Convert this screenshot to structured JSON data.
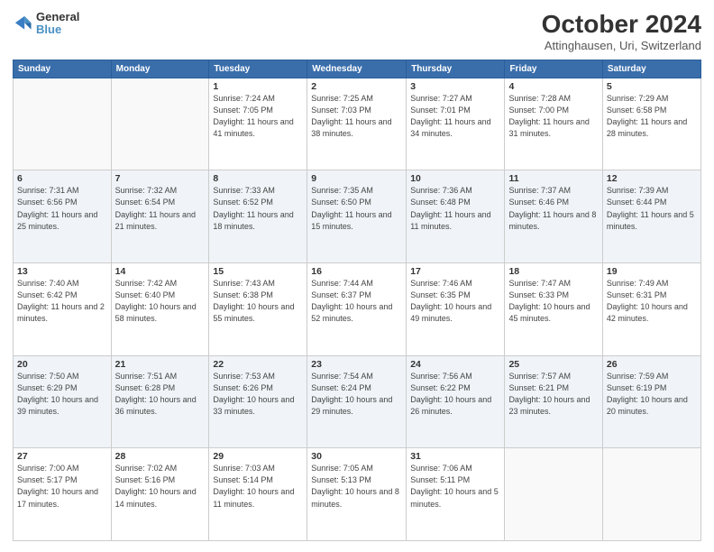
{
  "header": {
    "logo": {
      "line1": "General",
      "line2": "Blue"
    },
    "title": "October 2024",
    "location": "Attinghausen, Uri, Switzerland"
  },
  "days_of_week": [
    "Sunday",
    "Monday",
    "Tuesday",
    "Wednesday",
    "Thursday",
    "Friday",
    "Saturday"
  ],
  "weeks": [
    [
      {
        "day": "",
        "info": ""
      },
      {
        "day": "",
        "info": ""
      },
      {
        "day": "1",
        "info": "Sunrise: 7:24 AM\nSunset: 7:05 PM\nDaylight: 11 hours and 41 minutes."
      },
      {
        "day": "2",
        "info": "Sunrise: 7:25 AM\nSunset: 7:03 PM\nDaylight: 11 hours and 38 minutes."
      },
      {
        "day": "3",
        "info": "Sunrise: 7:27 AM\nSunset: 7:01 PM\nDaylight: 11 hours and 34 minutes."
      },
      {
        "day": "4",
        "info": "Sunrise: 7:28 AM\nSunset: 7:00 PM\nDaylight: 11 hours and 31 minutes."
      },
      {
        "day": "5",
        "info": "Sunrise: 7:29 AM\nSunset: 6:58 PM\nDaylight: 11 hours and 28 minutes."
      }
    ],
    [
      {
        "day": "6",
        "info": "Sunrise: 7:31 AM\nSunset: 6:56 PM\nDaylight: 11 hours and 25 minutes."
      },
      {
        "day": "7",
        "info": "Sunrise: 7:32 AM\nSunset: 6:54 PM\nDaylight: 11 hours and 21 minutes."
      },
      {
        "day": "8",
        "info": "Sunrise: 7:33 AM\nSunset: 6:52 PM\nDaylight: 11 hours and 18 minutes."
      },
      {
        "day": "9",
        "info": "Sunrise: 7:35 AM\nSunset: 6:50 PM\nDaylight: 11 hours and 15 minutes."
      },
      {
        "day": "10",
        "info": "Sunrise: 7:36 AM\nSunset: 6:48 PM\nDaylight: 11 hours and 11 minutes."
      },
      {
        "day": "11",
        "info": "Sunrise: 7:37 AM\nSunset: 6:46 PM\nDaylight: 11 hours and 8 minutes."
      },
      {
        "day": "12",
        "info": "Sunrise: 7:39 AM\nSunset: 6:44 PM\nDaylight: 11 hours and 5 minutes."
      }
    ],
    [
      {
        "day": "13",
        "info": "Sunrise: 7:40 AM\nSunset: 6:42 PM\nDaylight: 11 hours and 2 minutes."
      },
      {
        "day": "14",
        "info": "Sunrise: 7:42 AM\nSunset: 6:40 PM\nDaylight: 10 hours and 58 minutes."
      },
      {
        "day": "15",
        "info": "Sunrise: 7:43 AM\nSunset: 6:38 PM\nDaylight: 10 hours and 55 minutes."
      },
      {
        "day": "16",
        "info": "Sunrise: 7:44 AM\nSunset: 6:37 PM\nDaylight: 10 hours and 52 minutes."
      },
      {
        "day": "17",
        "info": "Sunrise: 7:46 AM\nSunset: 6:35 PM\nDaylight: 10 hours and 49 minutes."
      },
      {
        "day": "18",
        "info": "Sunrise: 7:47 AM\nSunset: 6:33 PM\nDaylight: 10 hours and 45 minutes."
      },
      {
        "day": "19",
        "info": "Sunrise: 7:49 AM\nSunset: 6:31 PM\nDaylight: 10 hours and 42 minutes."
      }
    ],
    [
      {
        "day": "20",
        "info": "Sunrise: 7:50 AM\nSunset: 6:29 PM\nDaylight: 10 hours and 39 minutes."
      },
      {
        "day": "21",
        "info": "Sunrise: 7:51 AM\nSunset: 6:28 PM\nDaylight: 10 hours and 36 minutes."
      },
      {
        "day": "22",
        "info": "Sunrise: 7:53 AM\nSunset: 6:26 PM\nDaylight: 10 hours and 33 minutes."
      },
      {
        "day": "23",
        "info": "Sunrise: 7:54 AM\nSunset: 6:24 PM\nDaylight: 10 hours and 29 minutes."
      },
      {
        "day": "24",
        "info": "Sunrise: 7:56 AM\nSunset: 6:22 PM\nDaylight: 10 hours and 26 minutes."
      },
      {
        "day": "25",
        "info": "Sunrise: 7:57 AM\nSunset: 6:21 PM\nDaylight: 10 hours and 23 minutes."
      },
      {
        "day": "26",
        "info": "Sunrise: 7:59 AM\nSunset: 6:19 PM\nDaylight: 10 hours and 20 minutes."
      }
    ],
    [
      {
        "day": "27",
        "info": "Sunrise: 7:00 AM\nSunset: 5:17 PM\nDaylight: 10 hours and 17 minutes."
      },
      {
        "day": "28",
        "info": "Sunrise: 7:02 AM\nSunset: 5:16 PM\nDaylight: 10 hours and 14 minutes."
      },
      {
        "day": "29",
        "info": "Sunrise: 7:03 AM\nSunset: 5:14 PM\nDaylight: 10 hours and 11 minutes."
      },
      {
        "day": "30",
        "info": "Sunrise: 7:05 AM\nSunset: 5:13 PM\nDaylight: 10 hours and 8 minutes."
      },
      {
        "day": "31",
        "info": "Sunrise: 7:06 AM\nSunset: 5:11 PM\nDaylight: 10 hours and 5 minutes."
      },
      {
        "day": "",
        "info": ""
      },
      {
        "day": "",
        "info": ""
      }
    ]
  ]
}
